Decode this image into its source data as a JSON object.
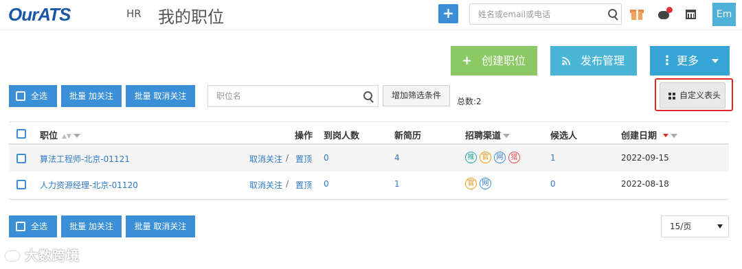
{
  "header": {
    "logo": "OurATS",
    "section": "HR",
    "title": "我的职位",
    "add_button": "+",
    "search_placeholder": "姓名或email或电话",
    "avatar": "Em",
    "icons": [
      "plus-icon",
      "search-icon",
      "gift-icon",
      "chat-icon",
      "calendar-icon"
    ],
    "notification_dot_color": "#e23030"
  },
  "actions": {
    "create": {
      "icon": "+",
      "label": "创建职位"
    },
    "publish": {
      "icon": "rss-icon",
      "label": "发布管理"
    },
    "more": {
      "icon": "⋮",
      "label": "更多"
    }
  },
  "toolbar": {
    "select_all": "全选",
    "batch_follow": "批量 加关注",
    "batch_unfollow": "批量 取消关注",
    "position_placeholder": "职位名",
    "add_filter": "增加筛选条件",
    "total": "总数:2",
    "custom_columns": "自定义表头"
  },
  "table": {
    "headers": {
      "position": "职位",
      "ops": "操作",
      "arrived": "到岗人数",
      "new_resumes": "新简历",
      "channels": "招聘渠道",
      "candidates": "候选人",
      "created": "创建日期"
    },
    "rows": [
      {
        "position": "算法工程师-北京-01121",
        "op_unfollow": "取消关注",
        "op_sep": "/",
        "op_top": "置顶",
        "arrived": "0",
        "new_resumes": "4",
        "channels": [
          "推",
          "官",
          "网",
          "猎"
        ],
        "candidates": "1",
        "created": "2022-09-15"
      },
      {
        "position": "人力资源经理-北京-01120",
        "op_unfollow": "取消关注",
        "op_sep": "/",
        "op_top": "置顶",
        "arrived": "0",
        "new_resumes": "1",
        "channels": [
          "官",
          "网"
        ],
        "candidates": "0",
        "created": "2022-08-18"
      }
    ]
  },
  "footer": {
    "select_all": "全选",
    "batch_follow": "批量 加关注",
    "batch_unfollow": "批量 取消关注",
    "page_size": "15/页"
  },
  "watermark": "大数跨境",
  "colors": {
    "primary": "#3a8fd6",
    "create": "#8cc863",
    "publish": "#4bb5d8",
    "more": "#37a6d6",
    "highlight": "#e32626"
  }
}
